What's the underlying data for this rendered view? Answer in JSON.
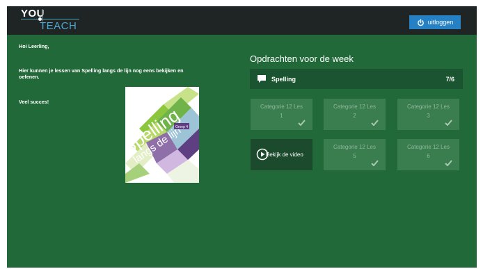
{
  "header": {
    "logo_top": "YOU",
    "logo_bottom": "TEACH",
    "logout_label": "uitloggen",
    "logout_icon": "power-icon"
  },
  "intro": {
    "greeting": "Hoi Leerling,",
    "description": "Hier kunnen je lessen van Spelling langs de lijn nog eens bekijken en oefenen.",
    "wish": "Veel succes!"
  },
  "book": {
    "title_line1": "Spelling",
    "title_line2": "langs de lijn",
    "grade": "Groep 4"
  },
  "week": {
    "title": "Opdrachten voor de week",
    "subject": "Spelling",
    "subject_icon": "chat-bubble-icon",
    "score": "7/6"
  },
  "tiles": [
    {
      "category": "Categorie 12 Les",
      "number": "1"
    },
    {
      "category": "Categorie 12 Les",
      "number": "2"
    },
    {
      "category": "Categorie 12 Les",
      "number": "3"
    },
    {
      "category": "Categorie 12 Les",
      "number": "5"
    },
    {
      "category": "Categorie 12 Les",
      "number": "6"
    }
  ],
  "video": {
    "label": "Bekijk de video",
    "icon": "play-circle-icon"
  },
  "colors": {
    "background": "#22693a",
    "topbar": "#1f2425",
    "button": "#2580c4",
    "tile": "#3a7d4f",
    "subject_bar": "#1b5430",
    "video_tile": "#1b4a2d"
  }
}
